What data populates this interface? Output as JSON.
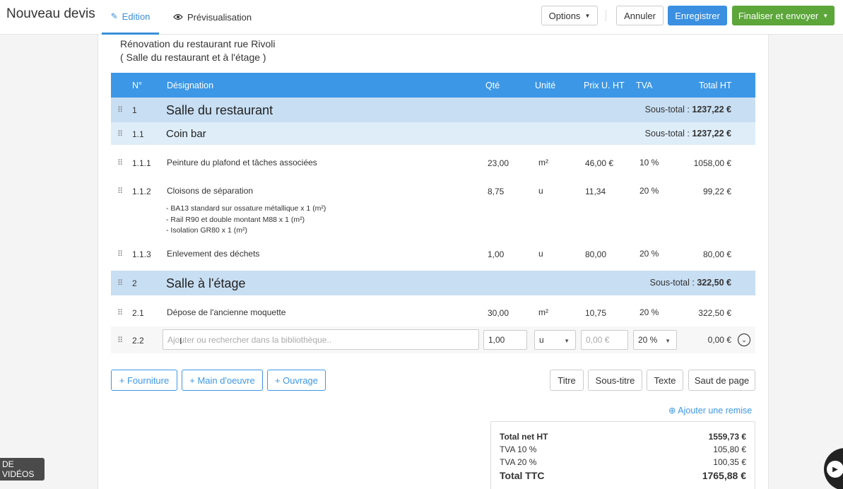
{
  "app": {
    "title": "Nouveau devis"
  },
  "tabs": {
    "edit": "Edition",
    "preview": "Prévisualisation"
  },
  "toolbar": {
    "options": "Options",
    "cancel": "Annuler",
    "save": "Enregistrer",
    "finalize": "Finaliser et envoyer"
  },
  "project": {
    "line1": "Rénovation du restaurant rue Rivoli",
    "line2": "( Salle du restaurant et à l'étage )"
  },
  "table": {
    "headers": [
      "N°",
      "Désignation",
      "Qté",
      "Unité",
      "Prix U. HT",
      "TVA",
      "Total HT"
    ],
    "subtotal_label": "Sous-total :",
    "sections": [
      {
        "num": "1",
        "title": "Salle du restaurant",
        "subtotal": "1237,22 €"
      },
      {
        "num": "1.1",
        "title": "Coin bar",
        "subtotal": "1237,22 €"
      },
      {
        "num": "2",
        "title": "Salle à l'étage",
        "subtotal": "322,50 €"
      }
    ],
    "items": [
      {
        "num": "1.1.1",
        "designation": "Peinture du plafond et tâches associées",
        "qty": "23,00",
        "unit": "m²",
        "price": "46,00 €",
        "tva": "10 %",
        "total": "1058,00 €"
      },
      {
        "num": "1.1.2",
        "designation": "Cloisons de séparation",
        "qty": "8,75",
        "unit": "u",
        "price": "11,34",
        "tva": "20 %",
        "total": "99,22 €",
        "details": [
          "- BA13 standard sur ossature métallique x 1 (m²)",
          "- Rail R90 et double montant M88 x 1 (m²)",
          "- Isolation GR80 x 1 (m²)"
        ]
      },
      {
        "num": "1.1.3",
        "designation": "Enlevement des déchets",
        "qty": "1,00",
        "unit": "u",
        "price": "80,00",
        "tva": "20 %",
        "total": "80,00 €"
      },
      {
        "num": "2.1",
        "designation": "Dépose de l'ancienne moquette",
        "qty": "30,00",
        "unit": "m²",
        "price": "10,75",
        "tva": "20 %",
        "total": "322,50 €"
      }
    ],
    "edit_row": {
      "num": "2.2",
      "placeholder": "Ajouter ou rechercher dans la bibliothèque..",
      "qty": "1,00",
      "unit": "u",
      "price_placeholder": "0,00 €",
      "tva": "20 %",
      "total": "0,00 €"
    }
  },
  "actions": {
    "add_supply": "+ Fourniture",
    "add_labor": "+ Main d'oeuvre",
    "add_work": "+ Ouvrage",
    "title": "Titre",
    "subtitle": "Sous-titre",
    "text": "Texte",
    "page_break": "Saut de page"
  },
  "discount_link": "Ajouter une remise",
  "totals": {
    "net_ht_label": "Total net HT",
    "net_ht": "1559,73 €",
    "tva10_label": "TVA 10 %",
    "tva10": "105,80 €",
    "tva20_label": "TVA 20 %",
    "tva20": "100,35 €",
    "ttc_label": "Total TTC",
    "ttc": "1765,88 €"
  },
  "video_badge": "DE VIDÉOS"
}
